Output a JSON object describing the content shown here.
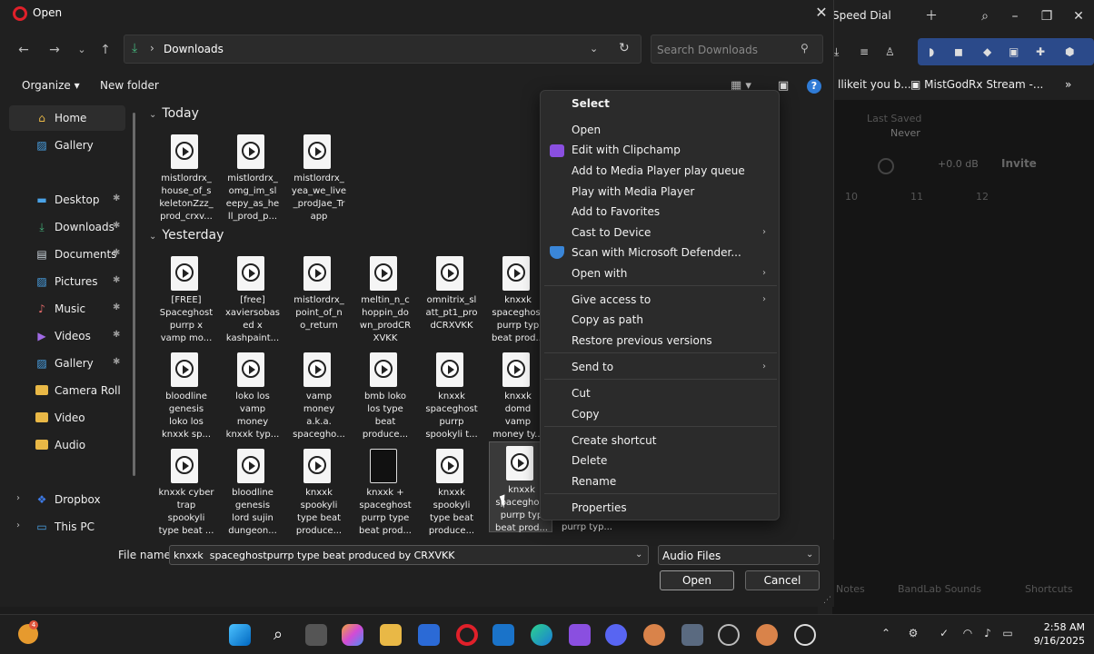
{
  "dialog": {
    "title": "Open",
    "address_path": "Downloads",
    "search_placeholder": "Search Downloads",
    "organize_label": "Organize ▾",
    "new_folder_label": "New folder"
  },
  "sidebar": {
    "items": [
      {
        "label": "Home",
        "icon": "home-icon"
      },
      {
        "label": "Gallery",
        "icon": "gallery-icon"
      },
      {
        "label": "Desktop",
        "icon": "desktop-icon"
      },
      {
        "label": "Downloads",
        "icon": "downloads-icon"
      },
      {
        "label": "Documents",
        "icon": "documents-icon"
      },
      {
        "label": "Pictures",
        "icon": "pictures-icon"
      },
      {
        "label": "Music",
        "icon": "music-icon"
      },
      {
        "label": "Videos",
        "icon": "videos-icon"
      },
      {
        "label": "Gallery",
        "icon": "gallery-icon"
      },
      {
        "label": "Camera Roll",
        "icon": "folder-icon"
      },
      {
        "label": "Video",
        "icon": "folder-icon"
      },
      {
        "label": "Audio",
        "icon": "folder-icon"
      },
      {
        "label": "Dropbox",
        "icon": "dropbox-icon"
      },
      {
        "label": "This PC",
        "icon": "pc-icon"
      }
    ]
  },
  "groups": {
    "today": "Today",
    "yesterday": "Yesterday"
  },
  "files": {
    "today": [
      "mistlordrx_\nhouse_of_s\nkeletonZzz_\nprod_crxv...",
      "mistlordrx_\nomg_im_sl\neepy_as_he\nll_prod_p...",
      "mistlordrx_\nyea_we_live\n_prodJae_Tr\napp"
    ],
    "yesterday_row1": [
      "[FREE]\nSpaceghost\npurrp x\nvamp mo...",
      "[free]\nxaviersobas\ned x\nkashpaint...",
      "mistlordrx_\npoint_of_n\no_return",
      "meltin_n_c\nhoppin_do\nwn_prodCR\nXVKK",
      "omnitrix_sl\natt_pt1_pro\ndCRXVKK",
      "knxxk\nspaceghost\npurrp typ\nbeat prod..."
    ],
    "yesterday_row2": [
      "bloodline\ngenesis\nloko los\nknxxk  sp...",
      "loko los\nvamp\nmoney\nknxxk typ...",
      "vamp\nmoney\na.k.a.\nspaceghо...",
      "bmb loko\nlos type\nbeat\nproduce...",
      "knxxk\nspaceghost\npurrp\nspookyli t...",
      "knxxk\ndomd\nvamp\nmoney ty..."
    ],
    "yesterday_row3": [
      "knxxk  cyber\ntrap\nspookyli\ntype beat ...",
      "bloodline\ngenesis\nlord sujin\ndungeon...",
      "knxxk\nspookyli\ntype beat\nproduce...",
      "knxxk +\nspaceghost\npurrp type\nbeat prod...",
      "knxxk\nspookyli\ntype beat\nproduce...",
      "knxxk\nspaceghost\npurrp typ\nbeat prod...",
      "purrp typ..."
    ]
  },
  "context_menu": {
    "header": "Select",
    "items": [
      "Open",
      "Edit with Clipchamp",
      "Add to Media Player play queue",
      "Play with Media Player",
      "Add to Favorites",
      "Cast to Device",
      "Scan with Microsoft Defender...",
      "Open with",
      "Give access to",
      "Copy as path",
      "Restore previous versions",
      "Send to",
      "Cut",
      "Copy",
      "Create shortcut",
      "Delete",
      "Rename",
      "Properties"
    ]
  },
  "bottom": {
    "file_name_label": "File name:",
    "file_name_value": "knxxk  spaceghostpurrp type beat produced by CRXVKK",
    "file_type": "Audio Files",
    "open_label": "Open",
    "cancel_label": "Cancel"
  },
  "background_app": {
    "tab_title": "Speed Dial",
    "bookmark1": "llikeit you b...",
    "bookmark2": "MistGodRx Stream -...",
    "last_saved": "Last Saved",
    "never": "Never",
    "db": "+0.0 dB",
    "invite": "Invite",
    "n10": "10",
    "n11": "11",
    "n12": "12",
    "notes": "Notes",
    "sounds": "BandLab Sounds",
    "shortcuts": "Shortcuts"
  },
  "taskbar": {
    "time": "2:58 AM",
    "date": "9/16/2025",
    "weather_badge": "4"
  },
  "colors": {
    "accent": "#2f7bd6",
    "folder": "#e9b846",
    "download_green": "#44b37b",
    "opera_red": "#e0202a"
  }
}
